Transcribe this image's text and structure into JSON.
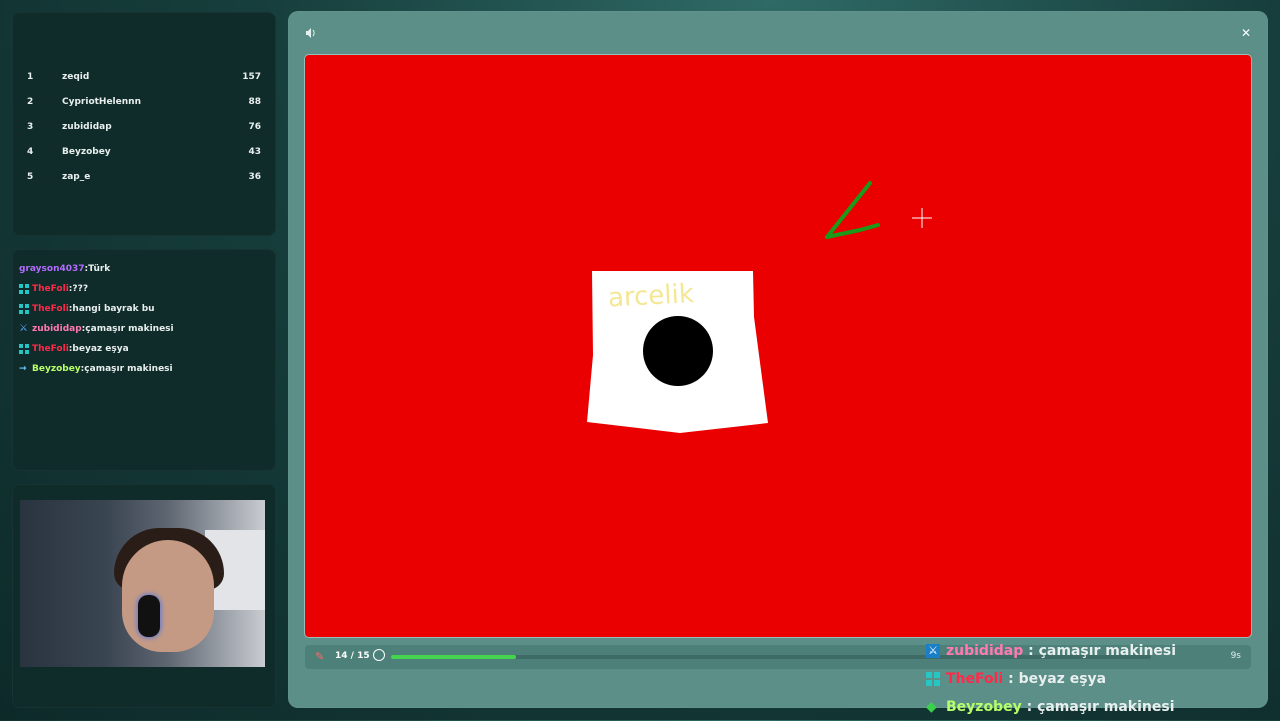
{
  "leaderboard": {
    "rows": [
      {
        "rank": "1",
        "name": "zeqid",
        "score": "157"
      },
      {
        "rank": "2",
        "name": "CypriotHelennn",
        "score": "88"
      },
      {
        "rank": "3",
        "name": "zubididap",
        "score": "76"
      },
      {
        "rank": "4",
        "name": "Beyzobey",
        "score": "43"
      },
      {
        "rank": "5",
        "name": "zap_e",
        "score": "36"
      }
    ]
  },
  "chat": {
    "messages": [
      {
        "user": "grayson4037",
        "text": "Türk",
        "color": "#b36cff",
        "badge": ""
      },
      {
        "user": "TheFoli",
        "text": "???",
        "color": "#ff2a4a",
        "badge": "sub"
      },
      {
        "user": "TheFoli",
        "text": "hangi bayrak bu",
        "color": "#ff2a4a",
        "badge": "sub"
      },
      {
        "user": "zubididap",
        "text": "çamaşır makinesi",
        "color": "#ff7ab0",
        "badge": "sword"
      },
      {
        "user": "TheFoli",
        "text": "beyaz eşya",
        "color": "#ff2a4a",
        "badge": "sub"
      },
      {
        "user": "Beyzobey",
        "text": "çamaşır makinesi",
        "color": "#b7ff6a",
        "badge": "arrow"
      }
    ]
  },
  "game": {
    "icons": {
      "sound": "speaker-icon",
      "close": "close-icon",
      "pencil": "pencil-icon",
      "timer": "timer-icon"
    },
    "round": "14 / 15",
    "progress": 0.165,
    "time_left": "9s",
    "canvas_bg": "#ea0000",
    "drawing_text": "arcelik"
  },
  "overlay_chat": {
    "messages": [
      {
        "user": "zubididap",
        "sep": " : ",
        "text": "çamaşır makinesi",
        "color": "#ff7ab0",
        "badge": "sword"
      },
      {
        "user": "TheFoli",
        "sep": " : ",
        "text": "beyaz eşya",
        "color": "#ff2a4a",
        "badge": "sub"
      },
      {
        "user": "Beyzobey",
        "sep": " : ",
        "text": "çamaşır makinesi",
        "color": "#b7ff6a",
        "badge": "gem"
      }
    ]
  }
}
